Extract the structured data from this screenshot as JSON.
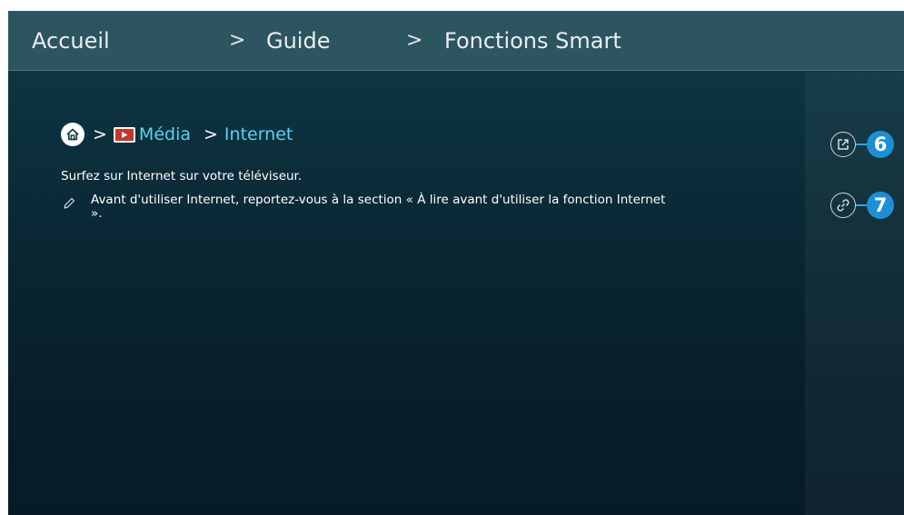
{
  "breadcrumb": [
    {
      "label": "Accueil"
    },
    {
      "label": "Guide"
    },
    {
      "label": "Fonctions Smart"
    }
  ],
  "breadcrumb_separator": ">",
  "path": {
    "separator": ">",
    "media_label": "Média",
    "internet_label": "Internet"
  },
  "description": "Surfez sur Internet sur votre téléviseur.",
  "note": "Avant d'utiliser Internet, reportez-vous à la section « À lire avant d'utiliser la fonction Internet ».",
  "side_actions": [
    {
      "icon": "external-link-icon",
      "badge": "6"
    },
    {
      "icon": "link-icon",
      "badge": "7"
    }
  ],
  "colors": {
    "accent": "#58d3f0",
    "badge": "#1e8fd5",
    "topbar": "#2c5560"
  }
}
